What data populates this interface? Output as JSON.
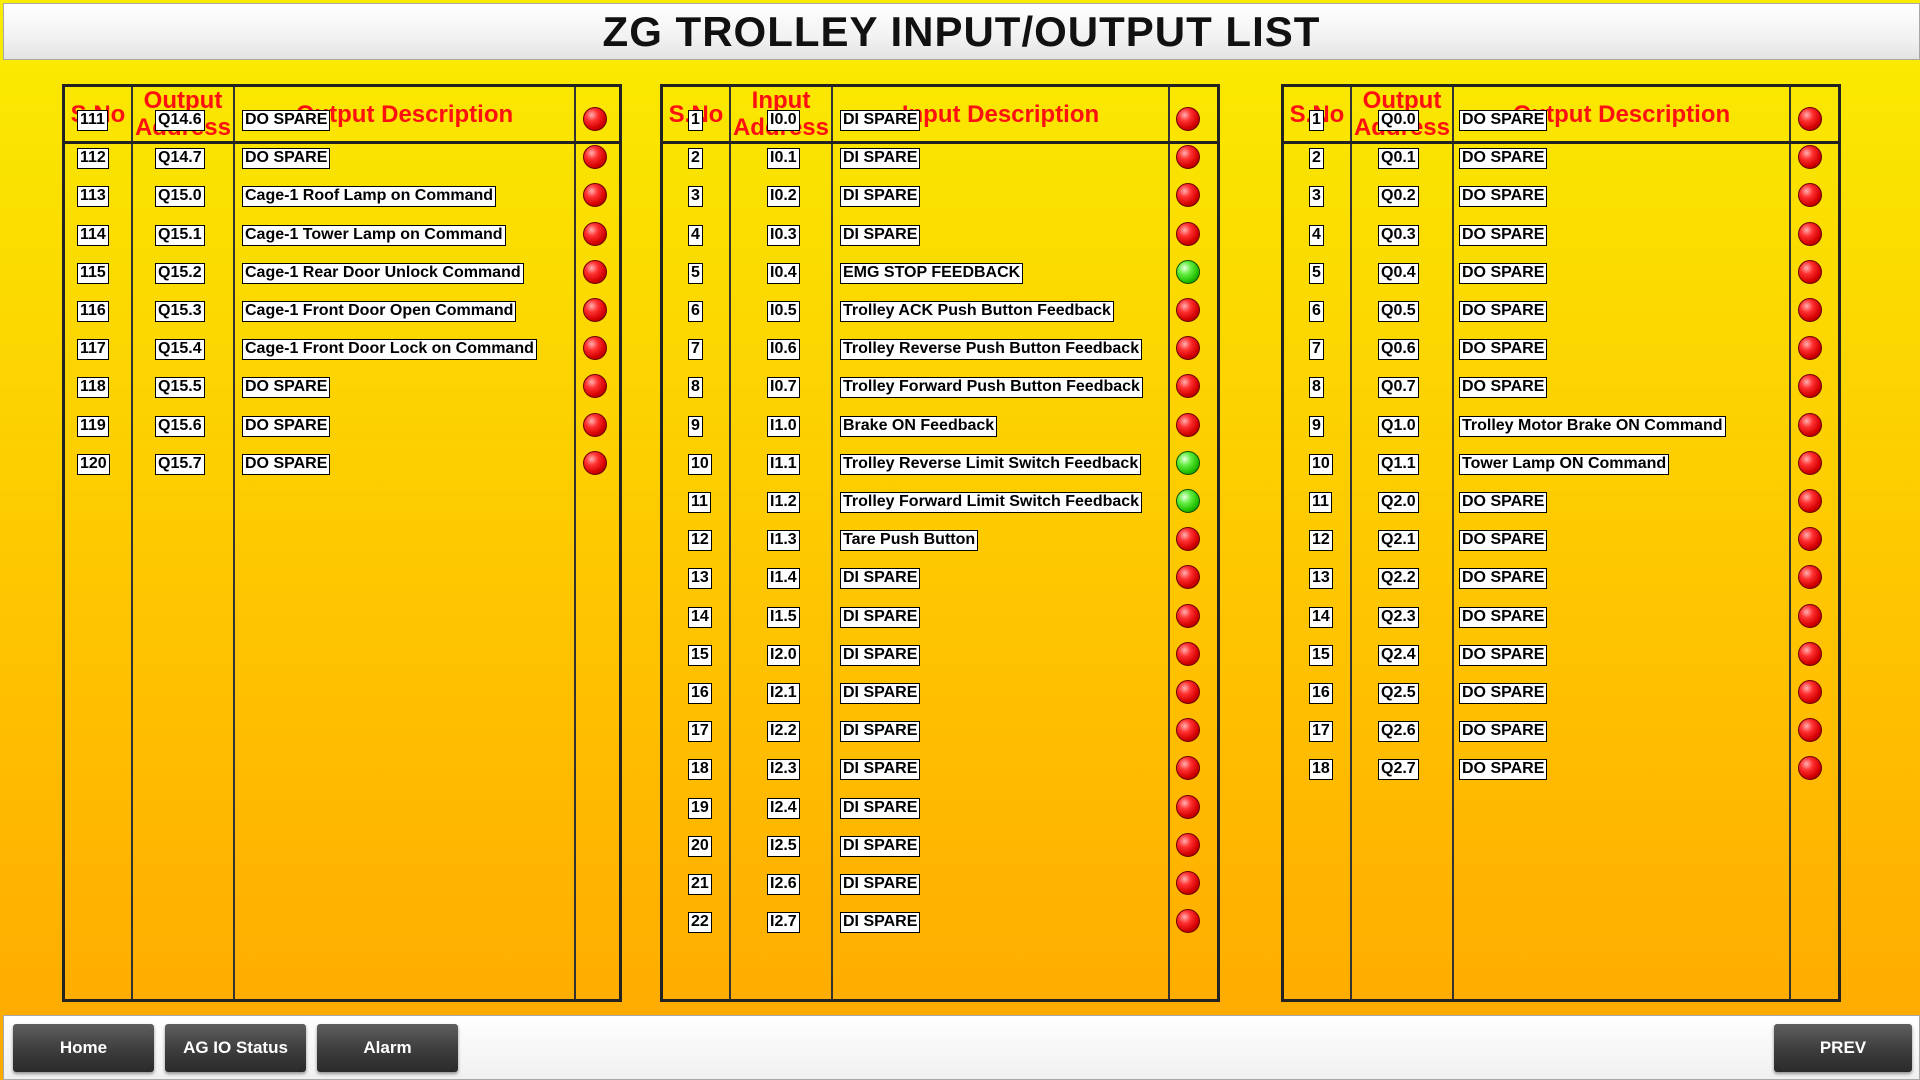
{
  "title": "ZG TROLLEY INPUT/OUTPUT LIST",
  "colors": {
    "header_text": "#ff1010",
    "led_off": "#e00000",
    "led_on": "#33cc11"
  },
  "panels": [
    {
      "id": "output-list-1",
      "headers": {
        "sno": "S.No",
        "address": "Output Address",
        "description": "Output Description"
      },
      "rows": [
        {
          "sno": "111",
          "addr": "Q14.6",
          "desc": "DO SPARE",
          "status": "off"
        },
        {
          "sno": "112",
          "addr": "Q14.7",
          "desc": "DO SPARE",
          "status": "off"
        },
        {
          "sno": "113",
          "addr": "Q15.0",
          "desc": "Cage-1 Roof Lamp on Command",
          "status": "off"
        },
        {
          "sno": "114",
          "addr": "Q15.1",
          "desc": "Cage-1 Tower Lamp on Command",
          "status": "off"
        },
        {
          "sno": "115",
          "addr": "Q15.2",
          "desc": "Cage-1 Rear Door Unlock Command",
          "status": "off"
        },
        {
          "sno": "116",
          "addr": "Q15.3",
          "desc": "Cage-1 Front Door Open Command",
          "status": "off"
        },
        {
          "sno": "117",
          "addr": "Q15.4",
          "desc": "Cage-1 Front Door Lock on Command",
          "status": "off"
        },
        {
          "sno": "118",
          "addr": "Q15.5",
          "desc": "DO SPARE",
          "status": "off"
        },
        {
          "sno": "119",
          "addr": "Q15.6",
          "desc": "DO SPARE",
          "status": "off"
        },
        {
          "sno": "120",
          "addr": "Q15.7",
          "desc": "DO SPARE",
          "status": "off"
        }
      ]
    },
    {
      "id": "input-list",
      "headers": {
        "sno": "S.No",
        "address": "Input Address",
        "description": "Input Description"
      },
      "rows": [
        {
          "sno": "1",
          "addr": "I0.0",
          "desc": "DI SPARE",
          "status": "off"
        },
        {
          "sno": "2",
          "addr": "I0.1",
          "desc": "DI SPARE",
          "status": "off"
        },
        {
          "sno": "3",
          "addr": "I0.2",
          "desc": "DI SPARE",
          "status": "off"
        },
        {
          "sno": "4",
          "addr": "I0.3",
          "desc": "DI SPARE",
          "status": "off"
        },
        {
          "sno": "5",
          "addr": "I0.4",
          "desc": "EMG STOP FEEDBACK",
          "status": "on"
        },
        {
          "sno": "6",
          "addr": "I0.5",
          "desc": "Trolley ACK Push Button Feedback",
          "status": "off"
        },
        {
          "sno": "7",
          "addr": "I0.6",
          "desc": "Trolley Reverse Push Button Feedback",
          "status": "off"
        },
        {
          "sno": "8",
          "addr": "I0.7",
          "desc": "Trolley Forward Push Button Feedback",
          "status": "off"
        },
        {
          "sno": "9",
          "addr": "I1.0",
          "desc": "Brake ON Feedback",
          "status": "off"
        },
        {
          "sno": "10",
          "addr": "I1.1",
          "desc": "Trolley Reverse Limit Switch Feedback",
          "status": "on"
        },
        {
          "sno": "11",
          "addr": "I1.2",
          "desc": "Trolley Forward Limit Switch Feedback",
          "status": "on"
        },
        {
          "sno": "12",
          "addr": "I1.3",
          "desc": "Tare Push Button",
          "status": "off"
        },
        {
          "sno": "13",
          "addr": "I1.4",
          "desc": "DI SPARE",
          "status": "off"
        },
        {
          "sno": "14",
          "addr": "I1.5",
          "desc": "DI SPARE",
          "status": "off"
        },
        {
          "sno": "15",
          "addr": "I2.0",
          "desc": "DI SPARE",
          "status": "off"
        },
        {
          "sno": "16",
          "addr": "I2.1",
          "desc": "DI SPARE",
          "status": "off"
        },
        {
          "sno": "17",
          "addr": "I2.2",
          "desc": "DI SPARE",
          "status": "off"
        },
        {
          "sno": "18",
          "addr": "I2.3",
          "desc": "DI SPARE",
          "status": "off"
        },
        {
          "sno": "19",
          "addr": "I2.4",
          "desc": "DI SPARE",
          "status": "off"
        },
        {
          "sno": "20",
          "addr": "I2.5",
          "desc": "DI SPARE",
          "status": "off"
        },
        {
          "sno": "21",
          "addr": "I2.6",
          "desc": "DI SPARE",
          "status": "off"
        },
        {
          "sno": "22",
          "addr": "I2.7",
          "desc": "DI SPARE",
          "status": "off"
        }
      ]
    },
    {
      "id": "output-list-2",
      "headers": {
        "sno": "S.No",
        "address": "Output Address",
        "description": "Output Description"
      },
      "rows": [
        {
          "sno": "1",
          "addr": "Q0.0",
          "desc": "DO SPARE",
          "status": "off"
        },
        {
          "sno": "2",
          "addr": "Q0.1",
          "desc": "DO SPARE",
          "status": "off"
        },
        {
          "sno": "3",
          "addr": "Q0.2",
          "desc": "DO SPARE",
          "status": "off"
        },
        {
          "sno": "4",
          "addr": "Q0.3",
          "desc": "DO SPARE",
          "status": "off"
        },
        {
          "sno": "5",
          "addr": "Q0.4",
          "desc": "DO SPARE",
          "status": "off"
        },
        {
          "sno": "6",
          "addr": "Q0.5",
          "desc": "DO SPARE",
          "status": "off"
        },
        {
          "sno": "7",
          "addr": "Q0.6",
          "desc": "DO SPARE",
          "status": "off"
        },
        {
          "sno": "8",
          "addr": "Q0.7",
          "desc": "DO SPARE",
          "status": "off"
        },
        {
          "sno": "9",
          "addr": "Q1.0",
          "desc": "Trolley Motor Brake ON Command",
          "status": "off"
        },
        {
          "sno": "10",
          "addr": "Q1.1",
          "desc": "Tower Lamp ON Command",
          "status": "off"
        },
        {
          "sno": "11",
          "addr": "Q2.0",
          "desc": "DO SPARE",
          "status": "off"
        },
        {
          "sno": "12",
          "addr": "Q2.1",
          "desc": "DO SPARE",
          "status": "off"
        },
        {
          "sno": "13",
          "addr": "Q2.2",
          "desc": "DO SPARE",
          "status": "off"
        },
        {
          "sno": "14",
          "addr": "Q2.3",
          "desc": "DO SPARE",
          "status": "off"
        },
        {
          "sno": "15",
          "addr": "Q2.4",
          "desc": "DO SPARE",
          "status": "off"
        },
        {
          "sno": "16",
          "addr": "Q2.5",
          "desc": "DO SPARE",
          "status": "off"
        },
        {
          "sno": "17",
          "addr": "Q2.6",
          "desc": "DO SPARE",
          "status": "off"
        },
        {
          "sno": "18",
          "addr": "Q2.7",
          "desc": "DO SPARE",
          "status": "off"
        }
      ]
    }
  ],
  "footer": {
    "home": "Home",
    "ag_io_status": "AG IO Status",
    "alarm": "Alarm",
    "prev": "PREV"
  }
}
